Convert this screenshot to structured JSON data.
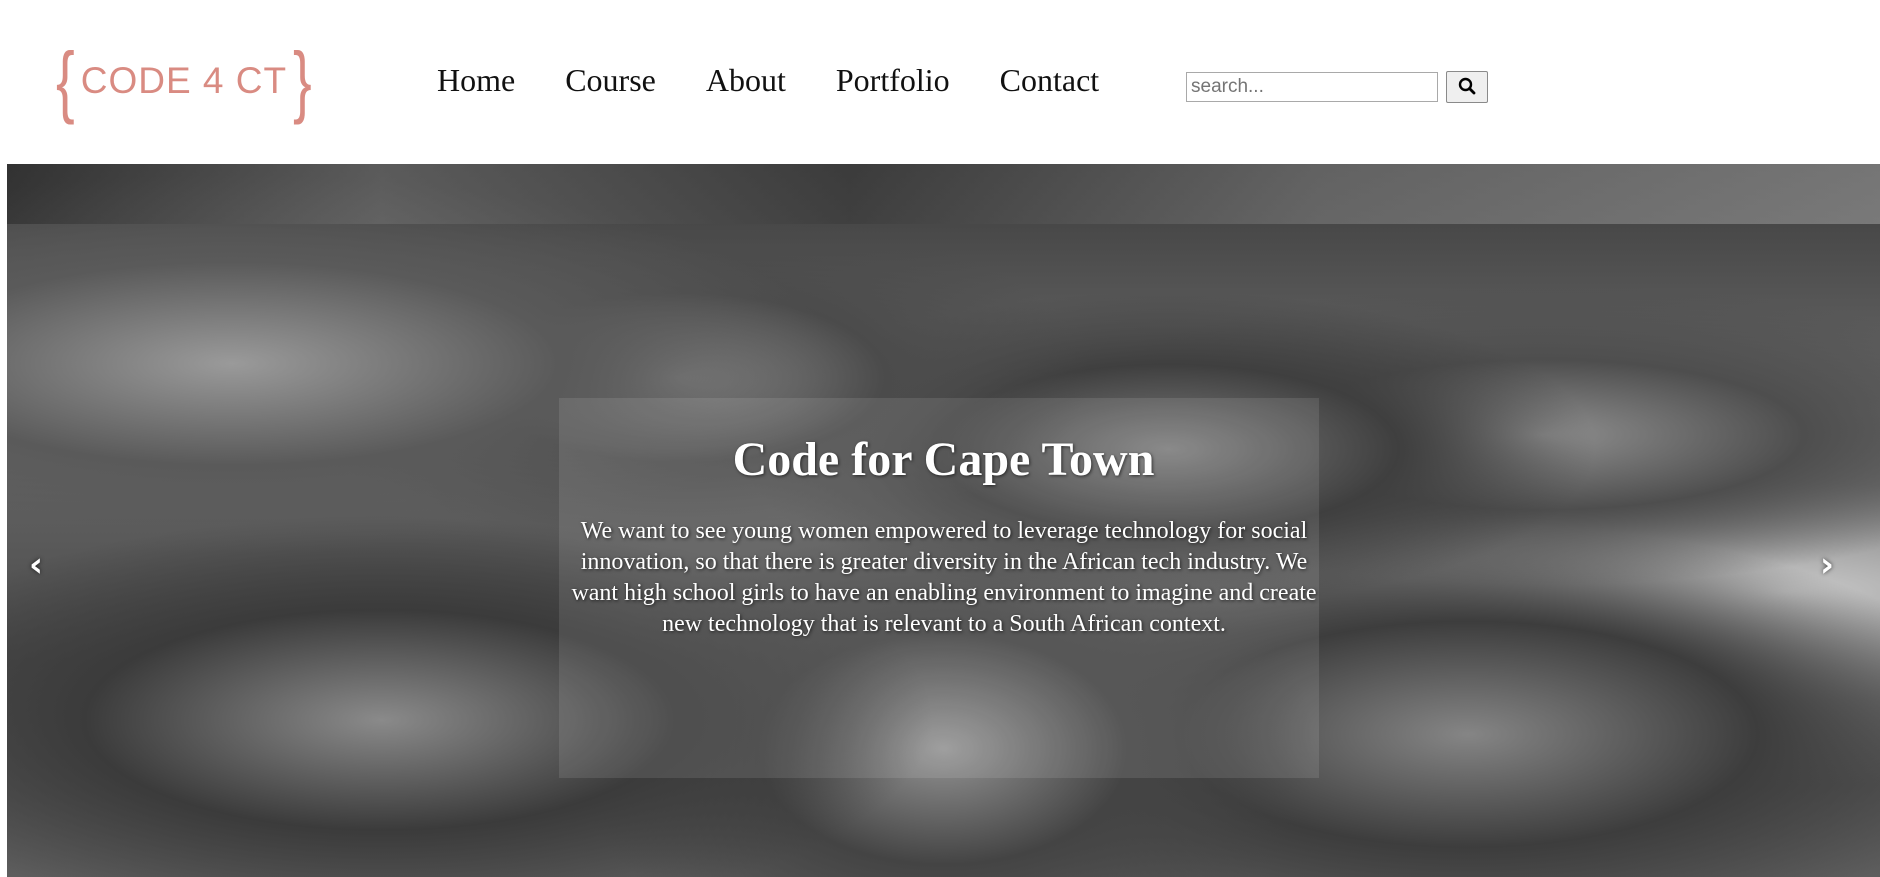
{
  "logo": {
    "brace_left": "{",
    "text": "CODE 4 CT",
    "brace_right": "}",
    "color": "#d98b82"
  },
  "nav": {
    "items": [
      {
        "label": "Home"
      },
      {
        "label": "Course"
      },
      {
        "label": "About"
      },
      {
        "label": "Portfolio"
      },
      {
        "label": "Contact"
      }
    ]
  },
  "search": {
    "placeholder": "search...",
    "value": "",
    "button_icon": "search-icon"
  },
  "hero": {
    "image": "group-photo-black-and-white",
    "title": "Code for Cape Town",
    "text": "We want to see young women empowered to leverage technology for social innovation, so that there is greater diversity in the African tech industry. We want high school girls to have an enabling environment to imagine and create new technology that is relevant to a South African context.",
    "prev_arrow": "‹",
    "next_arrow": "›"
  }
}
